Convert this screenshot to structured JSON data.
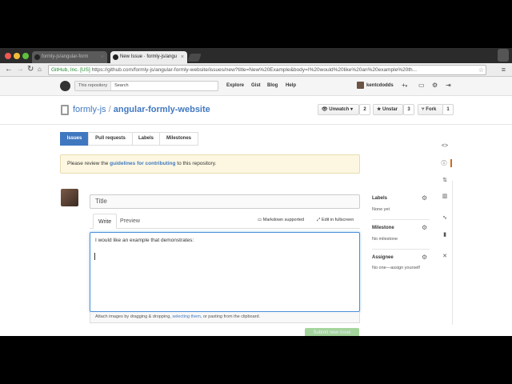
{
  "browser": {
    "tabs": [
      {
        "label": "formly-js/angular-form"
      },
      {
        "label": "New Issue · formly-js/angu"
      }
    ],
    "ev_label": "GitHub, Inc. [US]",
    "url": "https://github.com/formly-js/angular-formly-website/issues/new?title=New%20Example&body=I%20would%20like%20an%20example%20th..."
  },
  "header": {
    "scope": "This repository",
    "search_placeholder": "Search",
    "nav": [
      "Explore",
      "Gist",
      "Blog",
      "Help"
    ],
    "username": "kentcdodds",
    "plus": "+",
    "plus_caret": "▾"
  },
  "repo": {
    "owner": "formly-js",
    "separator": "/",
    "name": "angular-formly-website",
    "unwatch_label": "Unwatch ▾",
    "watch_count": "2",
    "unstar_label": "Unstar",
    "star_count": "3",
    "fork_label": "Fork",
    "fork_count": "1"
  },
  "subnav": [
    "Issues",
    "Pull requests",
    "Labels",
    "Milestones"
  ],
  "flash": {
    "pre": "Please review the ",
    "link": "guidelines for contributing",
    "post": " to this repository."
  },
  "form": {
    "title_placeholder": "Title",
    "tab_write": "Write",
    "tab_preview": "Preview",
    "markdown": "Markdown supported",
    "fullscreen": "Edit in fullscreen",
    "body": "I would like an example that demonstrates:",
    "attach_pre": "Attach images by dragging & dropping, ",
    "attach_link": "selecting them",
    "attach_post": ", or pasting from the clipboard.",
    "submit": "Submit new issue"
  },
  "sidebar": {
    "labels_title": "Labels",
    "labels_value": "None yet",
    "milestone_title": "Milestone",
    "milestone_value": "No milestone",
    "assignee_title": "Assignee",
    "assignee_value": "No one—assign yourself"
  },
  "colors": {
    "accent": "#4078c0",
    "flash_bg": "#fdf7e2",
    "submit": "#a4d59c",
    "ev_green": "#1f8a2e"
  }
}
